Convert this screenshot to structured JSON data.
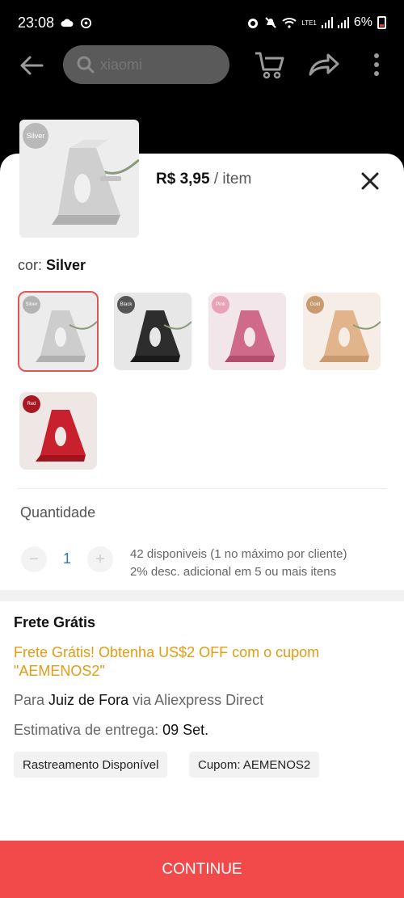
{
  "status_bar": {
    "time": "23:08",
    "battery": "6%",
    "network_label": "LTE1"
  },
  "app_bar": {
    "search_placeholder": "xiaomi"
  },
  "product": {
    "price": "R$ 3,95",
    "unit": "/ item",
    "color_prefix": "cor:",
    "selected_color": "Silver",
    "main_thumb_tag": "Silver"
  },
  "colors": [
    {
      "name": "Silver",
      "tag": "Silver",
      "hex": "#c9c9c9",
      "tag_hex": "#b3b3b3"
    },
    {
      "name": "Black",
      "tag": "Black",
      "hex": "#2a2a2a",
      "tag_hex": "#555555"
    },
    {
      "name": "Pink",
      "tag": "Pink",
      "hex": "#d06a8a",
      "tag_hex": "#e8a3b6"
    },
    {
      "name": "Gold",
      "tag": "Gold",
      "hex": "#e2b48c",
      "tag_hex": "#c89a70"
    },
    {
      "name": "Red",
      "tag": "Red",
      "hex": "#c8202c",
      "tag_hex": "#a81822"
    }
  ],
  "quantity": {
    "title": "Quantidade",
    "minus": "−",
    "value": "1",
    "plus": "+",
    "stock_line1": "42 disponiveis (1 no máximo por cliente)",
    "stock_line2": "2% desc. adicional em 5 ou mais itens"
  },
  "shipping": {
    "title": "Frete Grátis",
    "promo": "Frete Grátis! Obtenha US$2 OFF com o cupom \"AEMENOS2\"",
    "to_prefix": "Para",
    "city": "Juiz de Fora",
    "via": "via Aliexpress Direct",
    "eta_prefix": "Estimativa de entrega:",
    "eta_date": "09 Set.",
    "chips": [
      "Rastreamento Disponível",
      "Cupom: AEMENOS2"
    ]
  },
  "actions": {
    "continue": "CONTINUE"
  },
  "theme": {
    "accent": "#f24a4a",
    "promo": "#e39b12"
  }
}
